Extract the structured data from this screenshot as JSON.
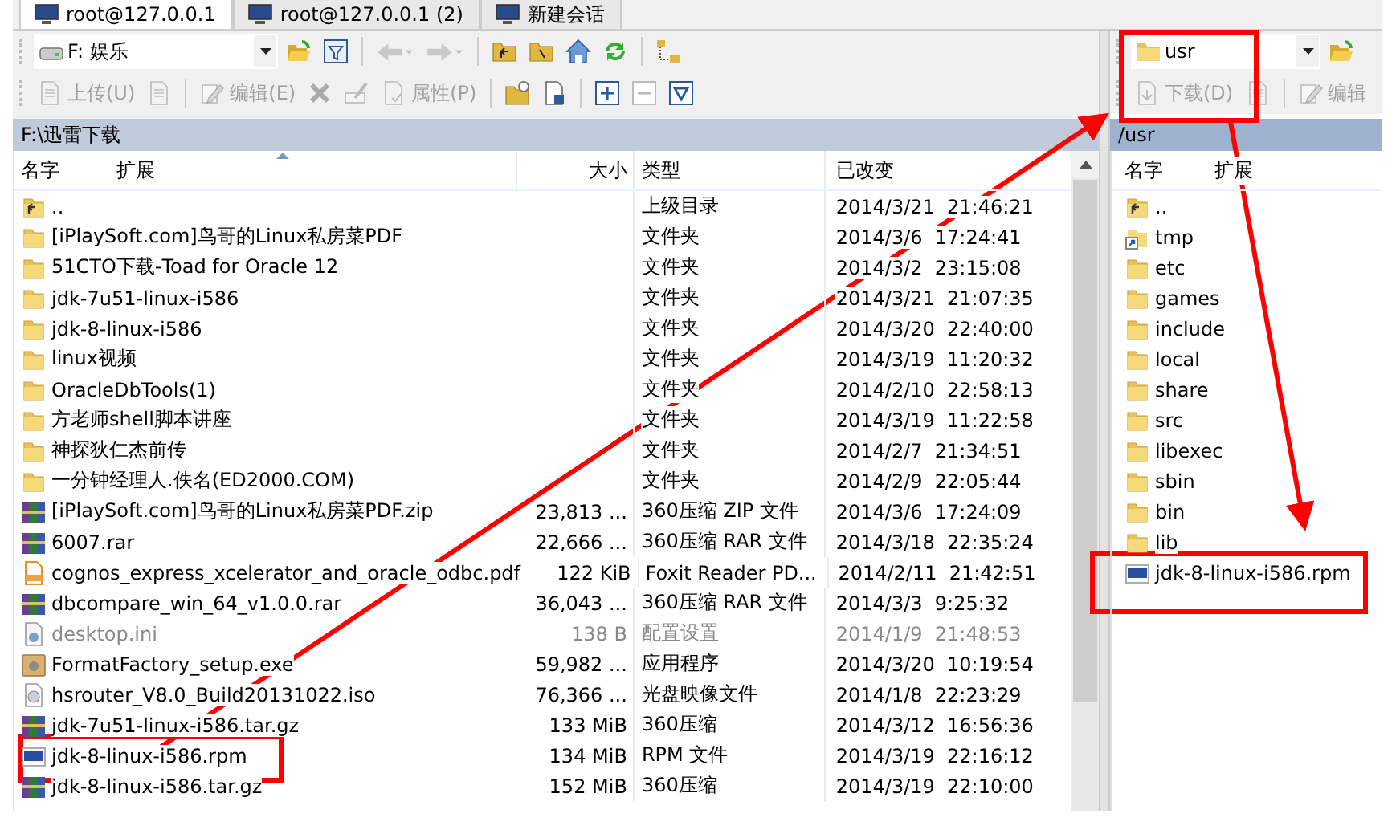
{
  "tabs": [
    {
      "label": "root@127.0.0.1",
      "selected": true
    },
    {
      "label": "root@127.0.0.1 (2)",
      "selected": false
    },
    {
      "label": "新建会话",
      "selected": false
    }
  ],
  "left": {
    "location": "F: 娱乐",
    "actions": [
      {
        "label": "上传(U)",
        "disabled": true
      },
      {
        "label": "编辑(E)",
        "disabled": true
      },
      {
        "label": "属性(P)",
        "disabled": true
      }
    ],
    "path": "F:\\迅雷下载",
    "columns": [
      "名字",
      "扩展",
      "大小",
      "类型",
      "已改变"
    ],
    "rows": [
      {
        "kind": "up",
        "name": "..",
        "size": "",
        "type": "上级目录",
        "modified": "2014/3/21  21:46:21",
        "hidden": false
      },
      {
        "kind": "folder",
        "name": "[iPlaySoft.com]鸟哥的Linux私房菜PDF",
        "size": "",
        "type": "文件夹",
        "modified": "2014/3/6  17:24:41",
        "hidden": false
      },
      {
        "kind": "folder",
        "name": "51CTO下载-Toad for Oracle 12",
        "size": "",
        "type": "文件夹",
        "modified": "2014/3/2  23:15:08",
        "hidden": false
      },
      {
        "kind": "folder",
        "name": "jdk-7u51-linux-i586",
        "size": "",
        "type": "文件夹",
        "modified": "2014/3/21  21:07:35",
        "hidden": false
      },
      {
        "kind": "folder",
        "name": "jdk-8-linux-i586",
        "size": "",
        "type": "文件夹",
        "modified": "2014/3/20  22:40:00",
        "hidden": false
      },
      {
        "kind": "folder",
        "name": "linux视频",
        "size": "",
        "type": "文件夹",
        "modified": "2014/3/19  11:20:32",
        "hidden": false
      },
      {
        "kind": "folder",
        "name": "OracleDbTools(1)",
        "size": "",
        "type": "文件夹",
        "modified": "2014/2/10  22:58:13",
        "hidden": false
      },
      {
        "kind": "folder",
        "name": "方老师shell脚本讲座",
        "size": "",
        "type": "文件夹",
        "modified": "2014/3/19  11:22:58",
        "hidden": false
      },
      {
        "kind": "folder",
        "name": "神探狄仁杰前传",
        "size": "",
        "type": "文件夹",
        "modified": "2014/2/7  21:34:51",
        "hidden": false
      },
      {
        "kind": "folder",
        "name": "一分钟经理人.佚名(ED2000.COM)",
        "size": "",
        "type": "文件夹",
        "modified": "2014/2/9  22:05:44",
        "hidden": false
      },
      {
        "kind": "archive",
        "name": "[iPlaySoft.com]鸟哥的Linux私房菜PDF.zip",
        "size": "23,813 ...",
        "type": "360压缩 ZIP 文件",
        "modified": "2014/3/6  17:24:09",
        "hidden": false
      },
      {
        "kind": "archive",
        "name": "6007.rar",
        "size": "22,666 ...",
        "type": "360压缩 RAR 文件",
        "modified": "2014/3/18  22:35:24",
        "hidden": false
      },
      {
        "kind": "pdf",
        "name": "cognos_express_xcelerator_and_oracle_odbc.pdf",
        "size": "122 KiB",
        "type": "Foxit Reader PD...",
        "modified": "2014/2/11  21:42:51",
        "hidden": false
      },
      {
        "kind": "archive",
        "name": "dbcompare_win_64_v1.0.0.rar",
        "size": "36,043 ...",
        "type": "360压缩 RAR 文件",
        "modified": "2014/3/3  9:25:32",
        "hidden": false
      },
      {
        "kind": "settings",
        "name": "desktop.ini",
        "size": "138 B",
        "type": "配置设置",
        "modified": "2014/1/9  21:48:53",
        "hidden": true
      },
      {
        "kind": "program",
        "name": "FormatFactory_setup.exe",
        "size": "59,982 ...",
        "type": "应用程序",
        "modified": "2014/3/20  10:19:54",
        "hidden": false
      },
      {
        "kind": "disc",
        "name": "hsrouter_V8.0_Build20131022.iso",
        "size": "76,366 ...",
        "type": "光盘映像文件",
        "modified": "2014/1/8  22:23:29",
        "hidden": false
      },
      {
        "kind": "archive",
        "name": "jdk-7u51-linux-i586.tar.gz",
        "size": "133 MiB",
        "type": "360压缩",
        "modified": "2014/3/12  16:56:36",
        "hidden": false
      },
      {
        "kind": "rpm",
        "name": "jdk-8-linux-i586.rpm",
        "size": "134 MiB",
        "type": "RPM 文件",
        "modified": "2014/3/19  22:16:12",
        "hidden": false
      },
      {
        "kind": "archive",
        "name": "jdk-8-linux-i586.tar.gz",
        "size": "152 MiB",
        "type": "360压缩",
        "modified": "2014/3/19  22:10:00",
        "hidden": false
      }
    ]
  },
  "right": {
    "location": "usr",
    "actions": [
      {
        "label": "下载(D)",
        "disabled": true
      },
      {
        "label": "编辑",
        "disabled": true
      }
    ],
    "path": "/usr",
    "columns": [
      "名字",
      "扩展"
    ],
    "rows": [
      {
        "kind": "up",
        "name": ".."
      },
      {
        "kind": "link",
        "name": "tmp"
      },
      {
        "kind": "folder",
        "name": "etc"
      },
      {
        "kind": "folder",
        "name": "games"
      },
      {
        "kind": "folder",
        "name": "include"
      },
      {
        "kind": "folder",
        "name": "local"
      },
      {
        "kind": "folder",
        "name": "share"
      },
      {
        "kind": "folder",
        "name": "src"
      },
      {
        "kind": "folder",
        "name": "libexec"
      },
      {
        "kind": "folder",
        "name": "sbin"
      },
      {
        "kind": "folder",
        "name": "bin"
      },
      {
        "kind": "folder",
        "name": "lib"
      },
      {
        "kind": "rpm",
        "name": "jdk-8-linux-i586.rpm"
      }
    ]
  }
}
